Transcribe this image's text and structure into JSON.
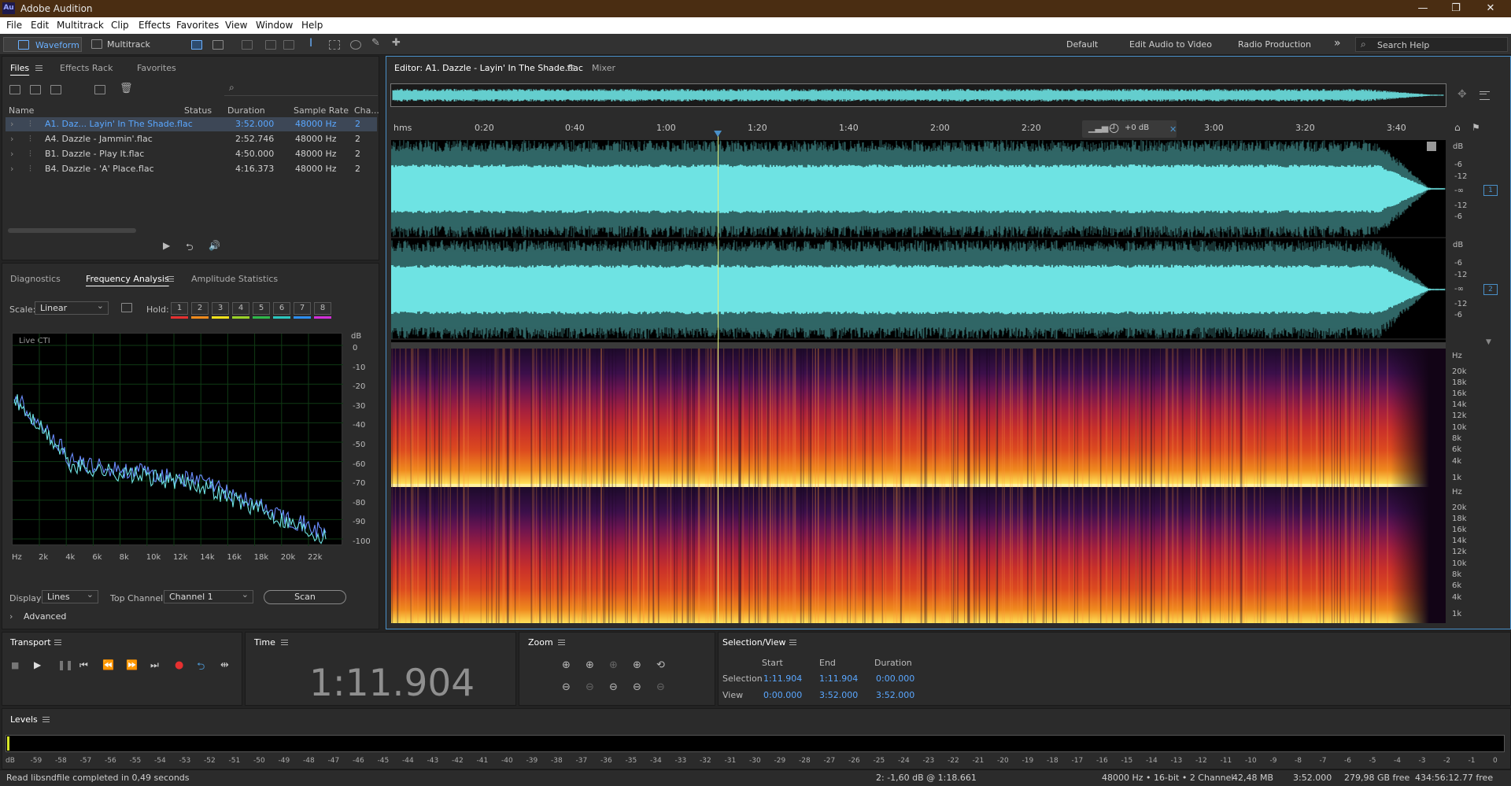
{
  "app": {
    "logo": "Au",
    "title": "Adobe Audition"
  },
  "window_controls": {
    "min": "—",
    "max": "❐",
    "close": "✕"
  },
  "menu": [
    "File",
    "Edit",
    "Multitrack",
    "Clip",
    "Effects",
    "Favorites",
    "View",
    "Window",
    "Help"
  ],
  "toolbar": {
    "waveform": "Waveform",
    "multitrack": "Multitrack",
    "workspaces": [
      "Default",
      "Edit Audio to Video",
      "Radio Production"
    ],
    "more": "»",
    "search_placeholder": "Search Help"
  },
  "files_panel": {
    "tabs": [
      "Files",
      "Effects Rack",
      "Favorites"
    ],
    "search_icon": "⌕",
    "columns": [
      "Name",
      "Status",
      "Duration",
      "Sample Rate",
      "Cha..."
    ],
    "rows": [
      {
        "name": "A1. Daz... Layin' In The Shade.flac",
        "status": "",
        "duration": "3:52.000",
        "rate": "48000 Hz",
        "ch": "2"
      },
      {
        "name": "A4. Dazzle - Jammin'.flac",
        "status": "",
        "duration": "2:52.746",
        "rate": "48000 Hz",
        "ch": "2"
      },
      {
        "name": "B1. Dazzle - Play It.flac",
        "status": "",
        "duration": "4:50.000",
        "rate": "48000 Hz",
        "ch": "2"
      },
      {
        "name": "B4. Dazzle - 'A' Place.flac",
        "status": "",
        "duration": "4:16.373",
        "rate": "48000 Hz",
        "ch": "2"
      }
    ]
  },
  "analysis_panel": {
    "tabs": [
      "Diagnostics",
      "Frequency Analysis",
      "Amplitude Statistics"
    ],
    "scale_label": "Scale:",
    "scale_value": "Linear",
    "hold_label": "Hold:",
    "hold": [
      {
        "n": "1",
        "color": "#e53030"
      },
      {
        "n": "2",
        "color": "#f08a1c"
      },
      {
        "n": "3",
        "color": "#f2e21b"
      },
      {
        "n": "4",
        "color": "#9ad228"
      },
      {
        "n": "5",
        "color": "#2fb84a"
      },
      {
        "n": "6",
        "color": "#2bc7c0"
      },
      {
        "n": "7",
        "color": "#2d8ef0"
      },
      {
        "n": "8",
        "color": "#d22fd8"
      }
    ],
    "live_label": "Live CTI",
    "db_axis": [
      "dB",
      "0",
      "-10",
      "-20",
      "-30",
      "-40",
      "-50",
      "-60",
      "-70",
      "-80",
      "-90",
      "-100"
    ],
    "freq_axis": [
      "Hz",
      "2k",
      "4k",
      "6k",
      "8k",
      "10k",
      "12k",
      "14k",
      "16k",
      "18k",
      "20k",
      "22k"
    ],
    "display_label": "Display:",
    "display_value": "Lines",
    "top_channel_label": "Top Channel:",
    "top_channel_value": "Channel 1",
    "scan_label": "Scan",
    "advanced_label": "Advanced"
  },
  "editor": {
    "tab": "Editor: A1. Dazzle - Layin' In The Shade.flac",
    "mixer": "Mixer",
    "ruler": [
      "hms",
      "0:20",
      "0:40",
      "1:00",
      "1:20",
      "1:40",
      "2:00",
      "2:20",
      "3:00",
      "3:20",
      "3:40"
    ],
    "gain": "+0 dB",
    "wave_db": [
      "dB",
      "-6",
      "-12",
      "-∞",
      "-12",
      "-6"
    ],
    "channel_badges": [
      "1",
      "2"
    ],
    "spec_hz": [
      "Hz",
      "20k",
      "18k",
      "16k",
      "14k",
      "12k",
      "10k",
      "8k",
      "6k",
      "4k",
      "1k"
    ],
    "playhead_fraction": 0.3098
  },
  "transport": {
    "title": "Transport"
  },
  "time_panel": {
    "title": "Time",
    "value": "1:11.904"
  },
  "zoom_panel": {
    "title": "Zoom"
  },
  "selection_panel": {
    "title": "Selection/View",
    "cols": [
      "Start",
      "End",
      "Duration"
    ],
    "selection_label": "Selection",
    "selection": [
      "1:11.904",
      "1:11.904",
      "0:00.000"
    ],
    "view_label": "View",
    "view": [
      "0:00.000",
      "3:52.000",
      "3:52.000"
    ]
  },
  "levels": {
    "title": "Levels",
    "scale": [
      "dB",
      "-59",
      "-58",
      "-57",
      "-56",
      "-55",
      "-54",
      "-53",
      "-52",
      "-51",
      "-50",
      "-49",
      "-48",
      "-47",
      "-46",
      "-45",
      "-44",
      "-43",
      "-42",
      "-41",
      "-40",
      "-39",
      "-38",
      "-37",
      "-36",
      "-35",
      "-34",
      "-33",
      "-32",
      "-31",
      "-30",
      "-29",
      "-28",
      "-27",
      "-26",
      "-25",
      "-24",
      "-23",
      "-22",
      "-21",
      "-20",
      "-19",
      "-18",
      "-17",
      "-16",
      "-15",
      "-14",
      "-13",
      "-12",
      "-11",
      "-10",
      "-9",
      "-8",
      "-7",
      "-6",
      "-5",
      "-4",
      "-3",
      "-2",
      "-1",
      "0"
    ]
  },
  "status": {
    "message": "Read libsndfile completed in 0,49 seconds",
    "cursor": "2: -1,60 dB @ 1:18.661",
    "format": "48000 Hz • 16-bit • 2 Channel",
    "size": "42,48 MB",
    "duration": "3:52.000",
    "free": "279,98 GB free",
    "free_time": "434:56:12.77 free"
  },
  "colors": {
    "accent": "#4aa3ff",
    "wave": "#6ee3e3",
    "active_border": "#4a90c8"
  }
}
